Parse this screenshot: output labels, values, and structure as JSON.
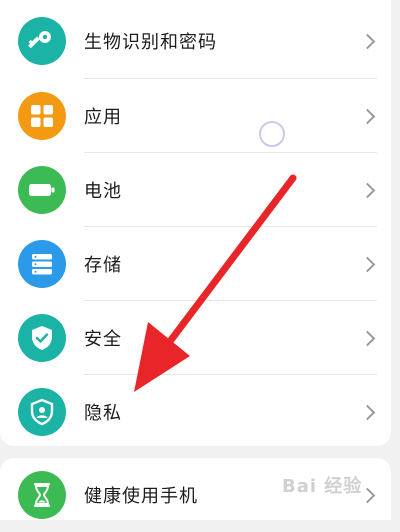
{
  "settings": {
    "items": [
      {
        "label": "生物识别和密码",
        "icon": "key-icon",
        "color": "#1bb3a6"
      },
      {
        "label": "应用",
        "icon": "apps-grid-icon",
        "color": "#f39a12"
      },
      {
        "label": "电池",
        "icon": "battery-icon",
        "color": "#3cba54"
      },
      {
        "label": "存储",
        "icon": "storage-icon",
        "color": "#2b9ae8"
      },
      {
        "label": "安全",
        "icon": "shield-check-icon",
        "color": "#1bb3a6"
      },
      {
        "label": "隐私",
        "icon": "privacy-shield-icon",
        "color": "#1bb3a6"
      }
    ],
    "bottom_items": [
      {
        "label": "健康使用手机",
        "icon": "hourglass-icon",
        "color": "#3cba54"
      }
    ]
  },
  "overlay": {
    "annotation_arrow_color": "#e8262a",
    "watermark": "Bai 经验"
  }
}
